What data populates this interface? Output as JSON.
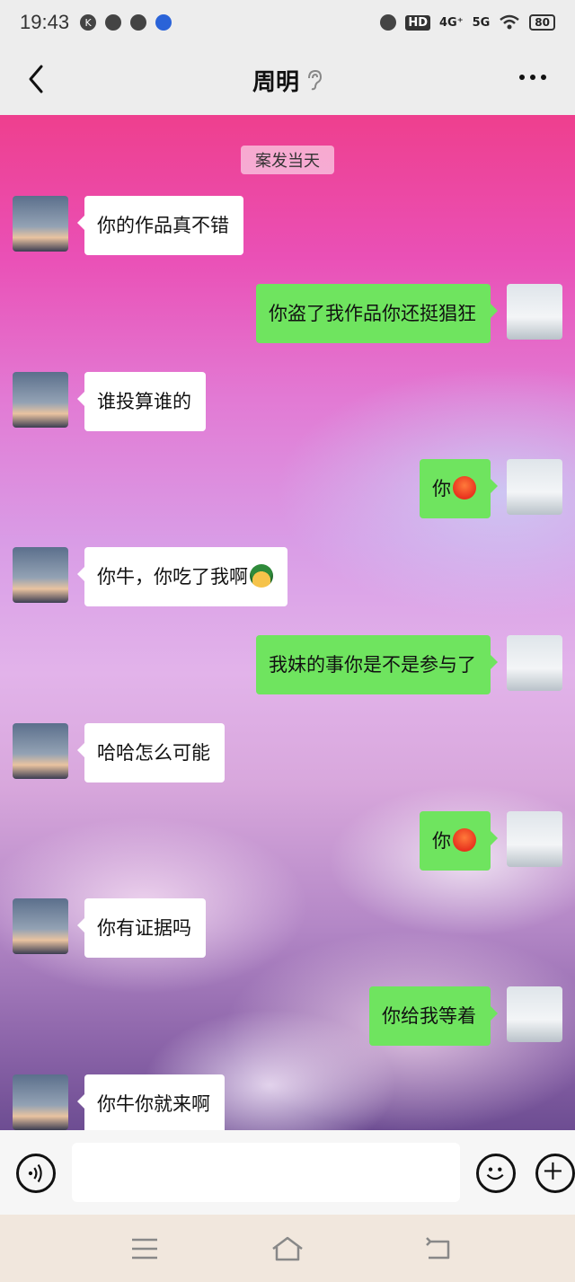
{
  "status_bar": {
    "time": "19:43",
    "network_1": "4G⁺",
    "network_2": "5G",
    "hd": "HD",
    "battery": "80"
  },
  "header": {
    "title": "周明"
  },
  "chat": {
    "time_divider": "案发当天",
    "messages": [
      {
        "side": "left",
        "text": "你的作品真不错"
      },
      {
        "side": "right",
        "text": "你盗了我作品你还挺猖狂"
      },
      {
        "side": "left",
        "text": "谁投算谁的"
      },
      {
        "side": "right",
        "text": "你",
        "emoji": "angry-face"
      },
      {
        "side": "left",
        "text": "你牛，你吃了我啊",
        "emoji": "helmet-face"
      },
      {
        "side": "right",
        "text": "我妹的事你是不是参与了"
      },
      {
        "side": "left",
        "text": "哈哈怎么可能"
      },
      {
        "side": "right",
        "text": "你",
        "emoji": "angry-face"
      },
      {
        "side": "left",
        "text": "你有证据吗"
      },
      {
        "side": "right",
        "text": "你给我等着"
      },
      {
        "side": "left",
        "text": "你牛你就来啊"
      }
    ]
  },
  "input_bar": {
    "value": ""
  },
  "icons": {
    "back": "back-arrow-icon",
    "ear": "earpiece-icon",
    "more": "more-dots-icon",
    "voice": "voice-icon",
    "emoji": "emoji-icon",
    "plus": "plus-icon",
    "nav_menu": "menu-icon",
    "nav_home": "home-icon",
    "nav_back": "back-icon"
  },
  "colors": {
    "my_bubble": "#6fe45f",
    "their_bubble": "#ffffff",
    "bar_background": "#ededed"
  }
}
